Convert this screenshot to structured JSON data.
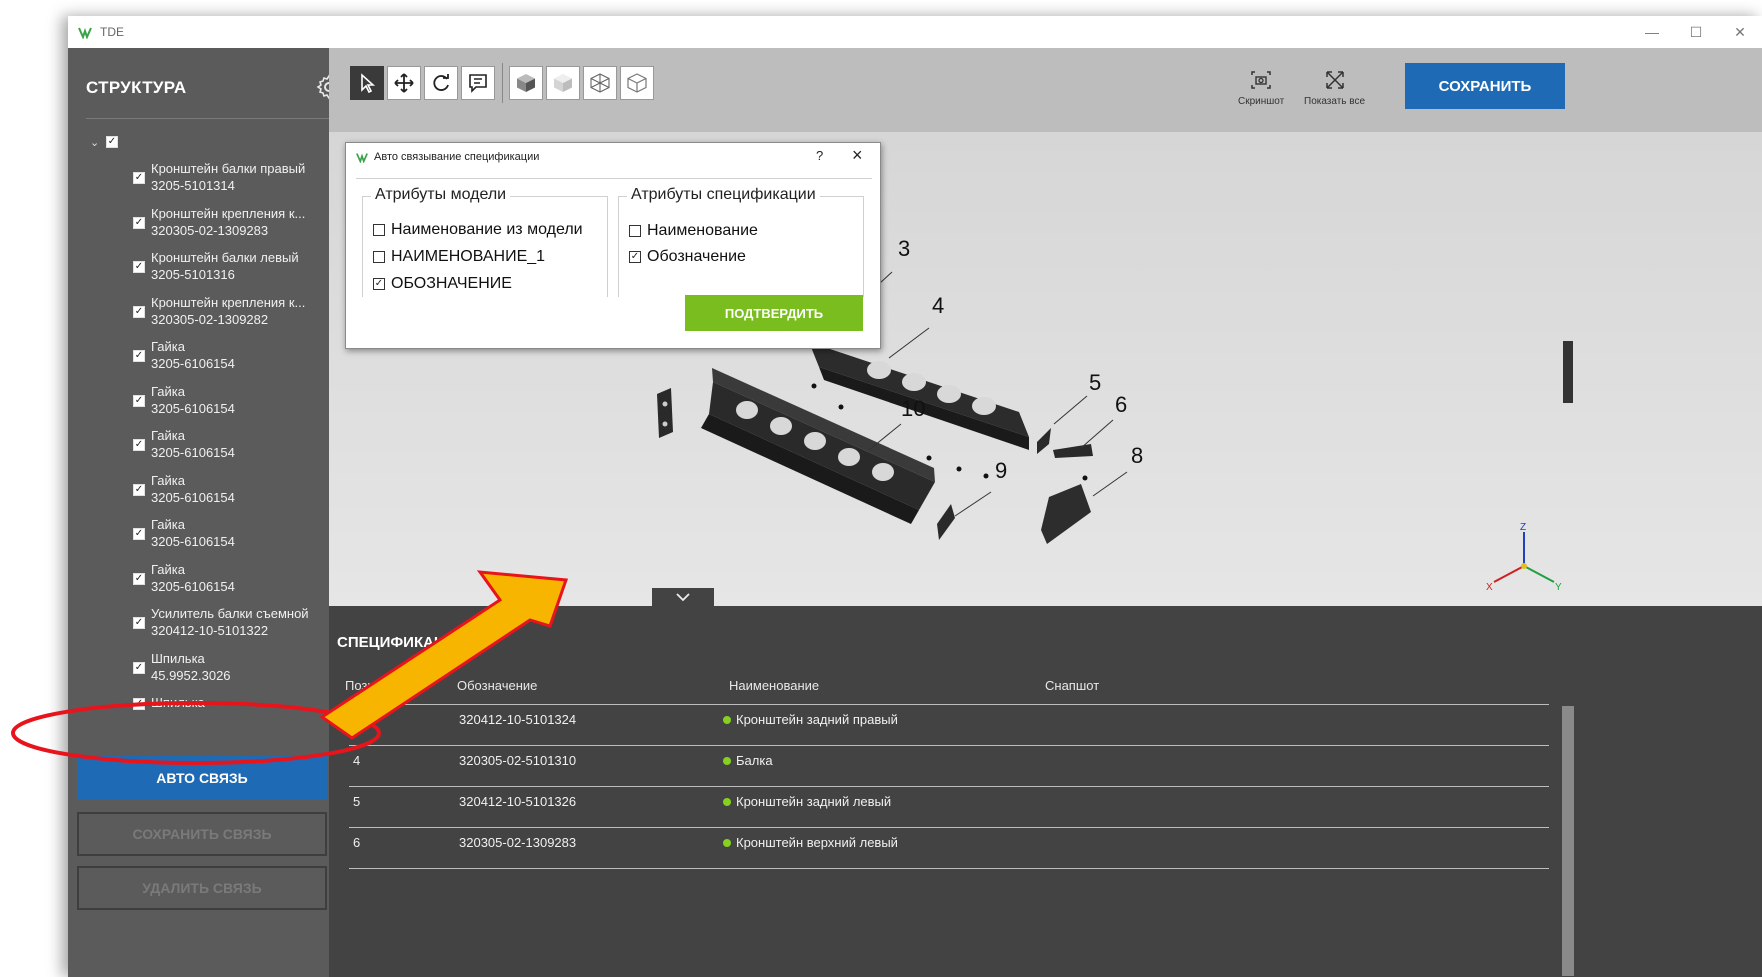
{
  "window": {
    "title": "TDE",
    "minimize": "—",
    "maximize": "☐",
    "close": "✕"
  },
  "sidebar": {
    "title": "СТРУКТУРА",
    "items": [
      {
        "line1": "Кронштейн балки правый",
        "line2": "3205-5101314"
      },
      {
        "line1": "Кронштейн крепления к...",
        "line2": "320305-02-1309283"
      },
      {
        "line1": "Кронштейн балки левый",
        "line2": "3205-5101316"
      },
      {
        "line1": "Кронштейн крепления к...",
        "line2": "320305-02-1309282"
      },
      {
        "line1": "Гайка",
        "line2": "3205-6106154"
      },
      {
        "line1": "Гайка",
        "line2": "3205-6106154"
      },
      {
        "line1": "Гайка",
        "line2": "3205-6106154"
      },
      {
        "line1": "Гайка",
        "line2": "3205-6106154"
      },
      {
        "line1": "Гайка",
        "line2": "3205-6106154"
      },
      {
        "line1": "Гайка",
        "line2": "3205-6106154"
      },
      {
        "line1": "Усилитель балки съемной",
        "line2": "320412-10-5101322"
      },
      {
        "line1": "Шпилька",
        "line2": "45.9952.3026"
      },
      {
        "line1": "Шпилька",
        "line2": ""
      }
    ],
    "buttons": {
      "auto": "АВТО СВЯЗЬ",
      "save": "СОХРАНИТЬ СВЯЗЬ",
      "delete": "УДАЛИТЬ СВЯЗЬ"
    }
  },
  "toolbar": {
    "screenshot": "Скриншот",
    "show_all": "Показать все",
    "save": "СОХРАНИТЬ"
  },
  "dialog": {
    "title": "Авто связывание спецификации",
    "help": "?",
    "model_attrs": {
      "legend": "Атрибуты модели",
      "options": [
        {
          "label": "Наименование из модели",
          "checked": false
        },
        {
          "label": "НАИМЕНОВАНИЕ_1",
          "checked": false
        },
        {
          "label": "ОБОЗНАЧЕНИЕ",
          "checked": true
        }
      ]
    },
    "spec_attrs": {
      "legend": "Атрибуты спецификации",
      "options": [
        {
          "label": "Наименование",
          "checked": false
        },
        {
          "label": "Обозначение",
          "checked": true
        }
      ]
    },
    "confirm": "ПОДТВЕРДИТЬ"
  },
  "viewport": {
    "callouts": [
      "3",
      "4",
      "5",
      "6",
      "8",
      "9",
      "10"
    ],
    "axes": {
      "x": "X",
      "y": "Y",
      "z": "Z"
    }
  },
  "spec": {
    "title": "СПЕЦИФИКАЦИЯ",
    "columns": [
      "Позиция",
      "Обозначение",
      "Наименование",
      "Снапшот"
    ],
    "rows": [
      {
        "pos": "",
        "code": "320412-10-5101324",
        "name": "Кронштейн задний правый"
      },
      {
        "pos": "4",
        "code": "320305-02-5101310",
        "name": "Балка"
      },
      {
        "pos": "5",
        "code": "320412-10-5101326",
        "name": "Кронштейн задний левый"
      },
      {
        "pos": "6",
        "code": "320305-02-1309283",
        "name": "Кронштейн верхний левый"
      }
    ]
  },
  "colors": {
    "accent_blue": "#1f6ab5",
    "confirm_green": "#79be1e",
    "annotation_red": "#e8141b",
    "annotation_arrow": "#f7b500"
  }
}
